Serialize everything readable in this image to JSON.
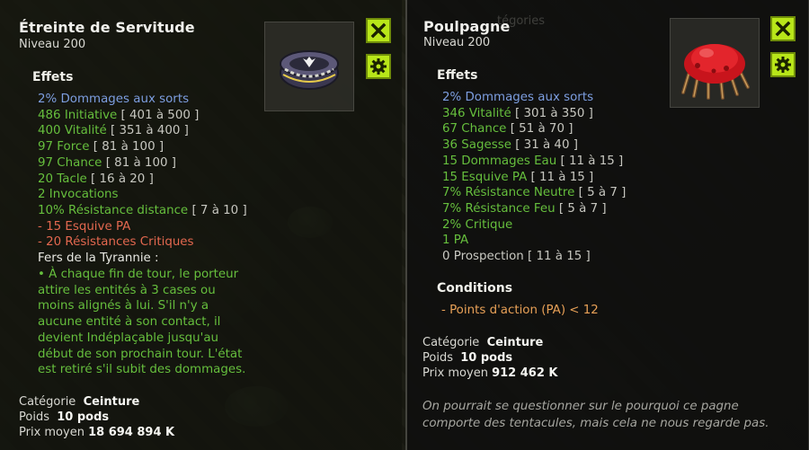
{
  "left": {
    "title": "Étreinte de Servitude",
    "level": "Niveau  200",
    "effects_heading": "Effets",
    "effects": [
      {
        "text": "2% Dommages aux sorts",
        "range": "",
        "color": "blue"
      },
      {
        "text": "486 Initiative",
        "range": "[ 401 à 500 ]",
        "color": "green"
      },
      {
        "text": "400 Vitalité",
        "range": "[ 351 à 400 ]",
        "color": "green"
      },
      {
        "text": "97 Force",
        "range": "[ 81 à 100 ]",
        "color": "green"
      },
      {
        "text": "97 Chance",
        "range": "[ 81 à 100 ]",
        "color": "green"
      },
      {
        "text": "20 Tacle",
        "range": "[ 16 à 20 ]",
        "color": "green"
      },
      {
        "text": "2 Invocations",
        "range": "",
        "color": "green"
      },
      {
        "text": "10% Résistance distance",
        "range": "[ 7 à 10 ]",
        "color": "green"
      },
      {
        "text": "- 15 Esquive PA",
        "range": "",
        "color": "red"
      },
      {
        "text": "- 20 Résistances Critiques",
        "range": "",
        "color": "red"
      }
    ],
    "set_title": "Fers de la Tyrannie :",
    "set_desc": [
      "• À chaque fin de tour, le porteur",
      "attire les entités à 3 cases ou",
      "moins alignés à lui. S'il n'y a",
      "aucune entité à son contact, il",
      "devient Indéplaçable jusqu'au",
      "début de son prochain tour. L'état",
      "est retiré s'il subit des dommages."
    ],
    "category_label": "Catégorie",
    "category_value": "Ceinture",
    "weight_label": "Poids",
    "weight_value": "10 pods",
    "price_label": "Prix moyen",
    "price_value": "18 694 894 K"
  },
  "right": {
    "title": "Poulpagne",
    "level": "Niveau  200",
    "effects_heading": "Effets",
    "effects": [
      {
        "text": "2% Dommages aux sorts",
        "range": "",
        "color": "blue"
      },
      {
        "text": "346 Vitalité",
        "range": "[ 301 à 350 ]",
        "color": "green"
      },
      {
        "text": "67 Chance",
        "range": "[ 51 à 70 ]",
        "color": "green"
      },
      {
        "text": "36 Sagesse",
        "range": "[ 31 à 40 ]",
        "color": "green"
      },
      {
        "text": "15 Dommages Eau",
        "range": "[ 11 à 15 ]",
        "color": "green"
      },
      {
        "text": "15 Esquive PA",
        "range": "[ 11 à 15 ]",
        "color": "green"
      },
      {
        "text": "7% Résistance Neutre",
        "range": "[ 5 à 7 ]",
        "color": "green"
      },
      {
        "text": "7% Résistance Feu",
        "range": "[ 5 à 7 ]",
        "color": "green"
      },
      {
        "text": "2% Critique",
        "range": "",
        "color": "green"
      },
      {
        "text": "1 PA",
        "range": "",
        "color": "green"
      },
      {
        "text": "0 Prospection",
        "range": "[ 11 à 15 ]",
        "color": "gray"
      }
    ],
    "conditions_heading": "Conditions",
    "condition": "- Points d'action (PA) < 12",
    "category_label": "Catégorie",
    "category_value": "Ceinture",
    "weight_label": "Poids",
    "weight_value": "10 pods",
    "price_label": "Prix moyen",
    "price_value": "912 462 K",
    "description": [
      "On pourrait se questionner sur le pourquoi ce pagne",
      "comporte des tentacules, mais cela ne nous regarde pas."
    ],
    "bg_category_hint": "tégories"
  },
  "icons": {
    "close": "close-icon",
    "settings": "gear-icon",
    "left_item": "belt-item-icon",
    "right_item": "octopus-belt-item-icon"
  },
  "colors": {
    "accent_button": "#b8e619",
    "effect_blue": "#7d9ee0",
    "effect_green": "#66bf3d",
    "effect_red": "#e3684f",
    "condition_orange": "#e7a057"
  }
}
